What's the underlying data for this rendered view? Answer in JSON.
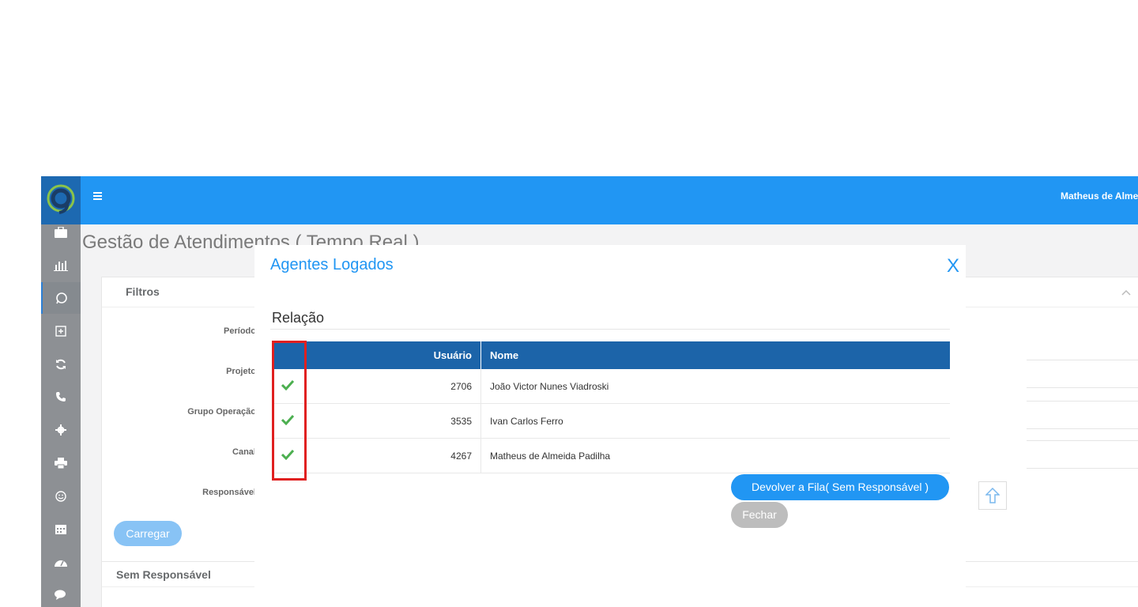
{
  "header": {
    "username": "Matheus de Almeida Padilha"
  },
  "page": {
    "title": "Gestão de Atendimentos ( Tempo Real )"
  },
  "filters": {
    "title": "Filtros",
    "labels": [
      "Período",
      "Projeto",
      "Grupo Operação",
      "Canal",
      "Responsável"
    ],
    "load_button": "Carregar"
  },
  "second_panel": {
    "title": "Sem Responsável"
  },
  "sidebar": {
    "icons": [
      "briefcase-icon",
      "bar-chart-icon",
      "whatsapp-icon",
      "plus-square-icon",
      "refresh-icon",
      "phone-icon",
      "gear-icon",
      "print-icon",
      "smile-icon",
      "calendar-icon",
      "dashboard-icon",
      "chat-icon"
    ]
  },
  "modal": {
    "title": "Agentes Logados",
    "close": "X",
    "section_title": "Relação",
    "table": {
      "headers": {
        "user": "Usuário",
        "name": "Nome"
      },
      "rows": [
        {
          "user": "2706",
          "name": "João Victor Nunes Viadroski"
        },
        {
          "user": "3535",
          "name": "Ivan Carlos Ferro"
        },
        {
          "user": "4267",
          "name": "Matheus de Almeida Padilha"
        }
      ]
    },
    "return_button": "Devolver a Fila( Sem Responsável )",
    "close_button": "Fechar"
  },
  "colors": {
    "accent": "#2196f3",
    "header_dark": "#1c64a9",
    "highlight": "#e02020",
    "check": "#4caf50"
  }
}
